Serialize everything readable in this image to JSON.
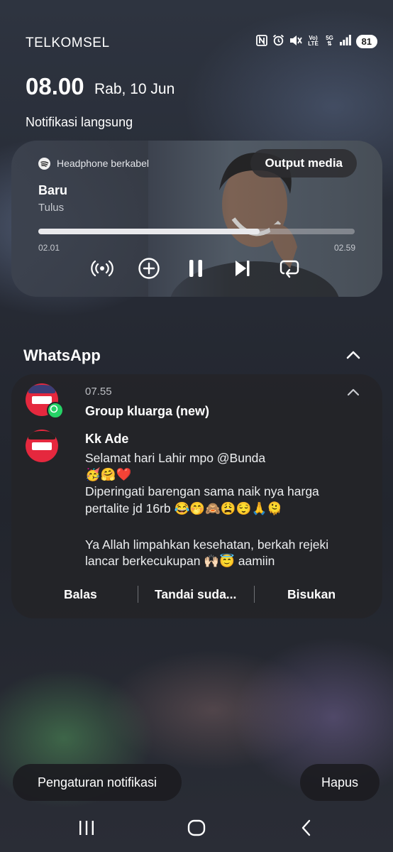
{
  "status_bar": {
    "carrier": "TELKOMSEL",
    "battery": "81",
    "icons": [
      "nfc-icon",
      "alarm-icon",
      "mute-icon",
      "volte-icon",
      "5g-icon",
      "signal-icon",
      "battery-icon"
    ],
    "volte_label": "Vo) LTE",
    "net_label": "5G"
  },
  "clock": {
    "time": "08.00",
    "date": "Rab, 10 Jun"
  },
  "live_notifications_title": "Notifikasi langsung",
  "media": {
    "source": "Headphone berkabel",
    "output_label": "Output media",
    "title": "Baru",
    "artist": "Tulus",
    "elapsed": "02.01",
    "total": "02.59",
    "progress": 0.7,
    "controls": [
      "broadcast-icon",
      "add-icon",
      "pause-icon",
      "next-icon",
      "repeat-icon"
    ]
  },
  "whatsapp": {
    "app_name": "WhatsApp",
    "time": "07.55",
    "group": "Group kluarga (new)",
    "sender": "Kk Ade",
    "message_lines": [
      "Selamat hari Lahir mpo @Bunda",
      "🥳🤗❤️",
      "Diperingati barengan sama naik nya harga",
      "pertalite jd 16rb 😂🤭🙈😩😌🙏🫠",
      "",
      "Ya Allah limpahkan kesehatan, berkah rejeki",
      "lancar berkecukupan 🙌🏻😇 aamiin"
    ],
    "actions": {
      "reply": "Balas",
      "mark_read": "Tandai suda...",
      "mute": "Bisukan"
    }
  },
  "bottom": {
    "settings": "Pengaturan notifikasi",
    "clear": "Hapus"
  },
  "colors": {
    "whatsapp_green": "#25d366",
    "avatar_red": "#e5283e"
  }
}
